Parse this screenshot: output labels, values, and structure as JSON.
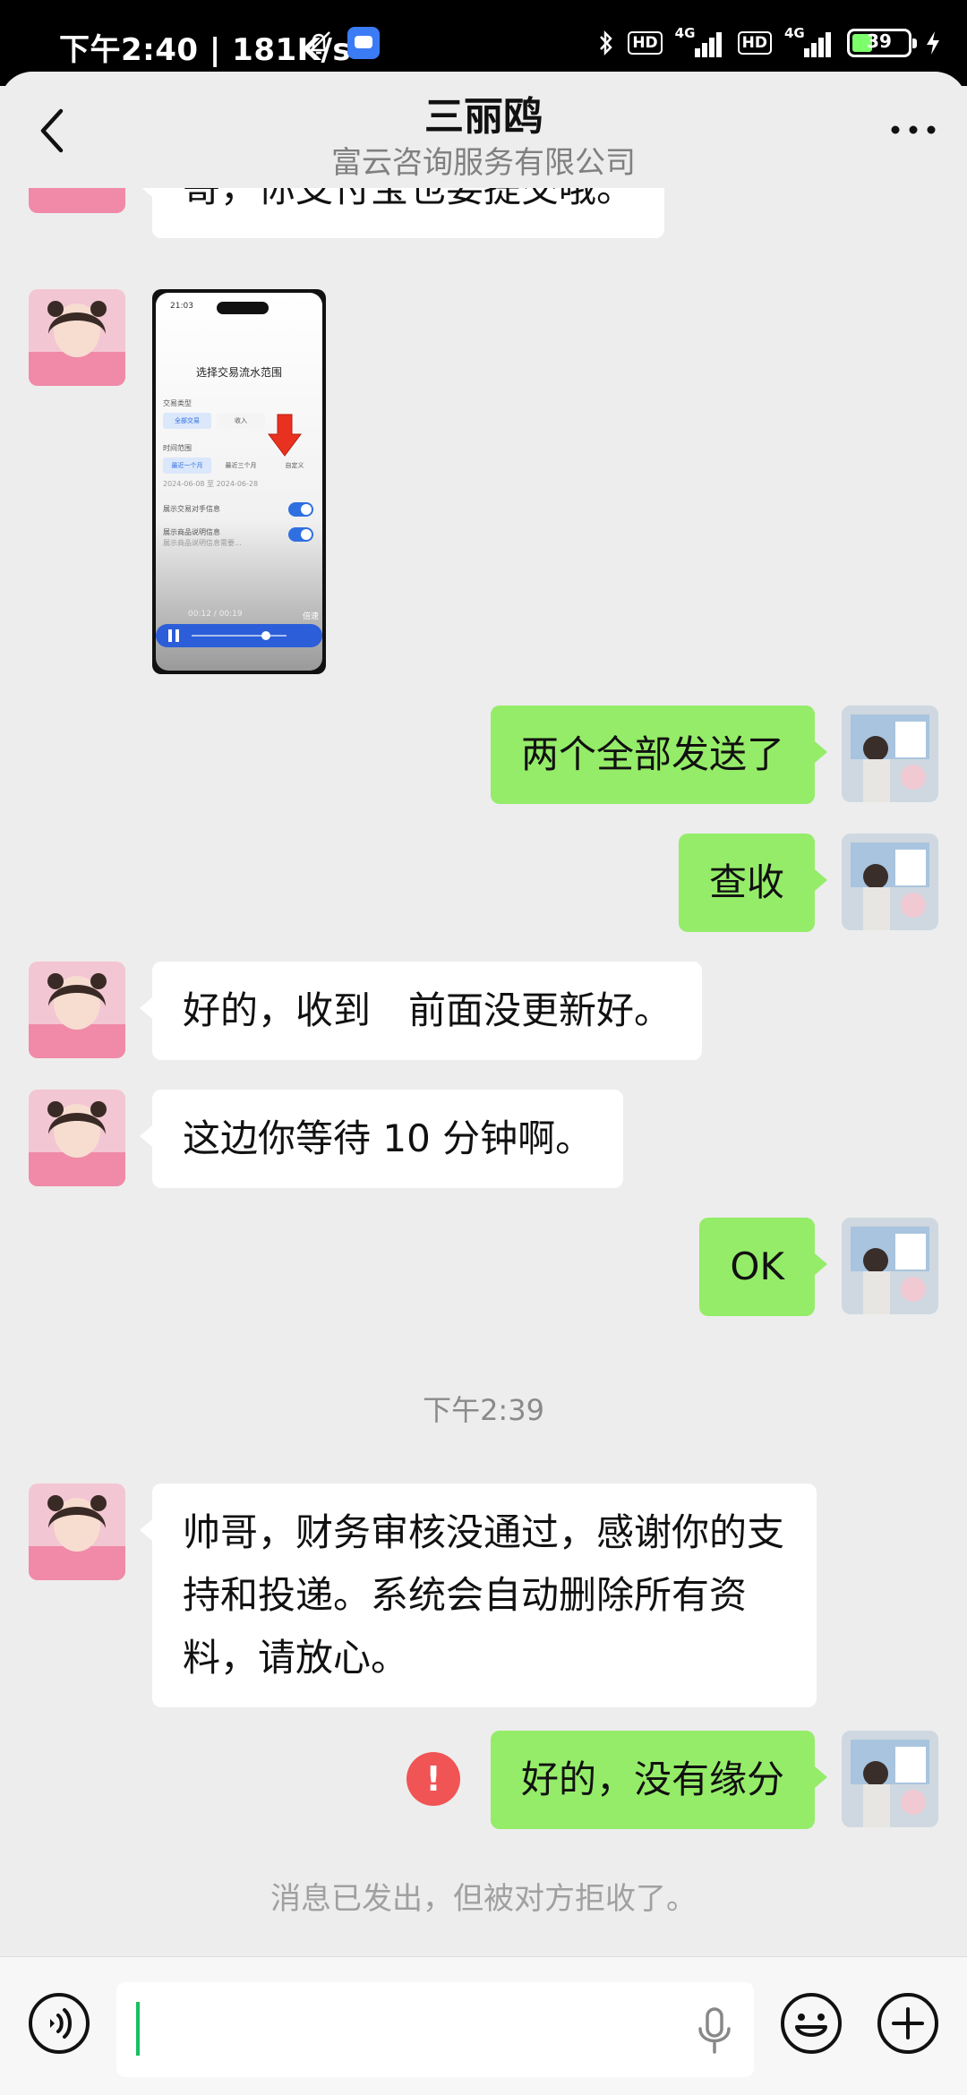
{
  "status_bar": {
    "time": "下午2:40",
    "speed": "181K/s",
    "hd1": "HD",
    "hd2": "HD",
    "net1": "4G",
    "net2": "4G",
    "battery": "39"
  },
  "header": {
    "title": "三丽鸥",
    "subtitle": "富云咨询服务有限公司"
  },
  "messages": [
    {
      "side": "in",
      "text": "哥，你支付宝也要提交哦。"
    },
    {
      "side": "in",
      "type": "video"
    },
    {
      "side": "out",
      "text": "两个全部发送了"
    },
    {
      "side": "out",
      "text": "查收"
    },
    {
      "side": "in",
      "text": "好的，收到　前面没更新好。"
    },
    {
      "side": "in",
      "text": "这边你等待 10 分钟啊。"
    },
    {
      "side": "out",
      "text": "OK"
    },
    {
      "type": "time",
      "text": "下午2:39"
    },
    {
      "side": "in",
      "text": "帅哥，财务审核没通过，感谢你的支持和投递。系统会自动删除所有资料，请放心。"
    },
    {
      "side": "out",
      "text": "好的，没有缘分",
      "error": true
    },
    {
      "type": "system",
      "text": "消息已发出，但被对方拒收了。"
    }
  ],
  "video_screen": {
    "clock": "21:03",
    "title": "选择交易流水范围",
    "type_label": "交易类型",
    "type_all": "全部交易",
    "type_income": "收入",
    "range_label": "时间范围",
    "range_1": "最近一个月",
    "range_3": "最近三个月",
    "range_custom": "自定义",
    "date_range": "2024-06-08 至 2024-06-28",
    "toggle1": "展示交易对手信息",
    "toggle2": "展示商品说明信息",
    "toggle2_hint": "展示商品说明信息需要...",
    "playtime": "00:12 / 00:19",
    "player_label": "倍速"
  },
  "colors": {
    "outgoing_bubble": "#95ec69",
    "incoming_bubble": "#ffffff",
    "chat_bg": "#ededed",
    "error": "#f05454"
  },
  "icons": {
    "back": "chevron-left-icon",
    "more": "more-dots-icon",
    "voice": "voice-icon",
    "mic": "mic-icon",
    "emoji": "emoji-icon",
    "plus": "plus-icon"
  }
}
